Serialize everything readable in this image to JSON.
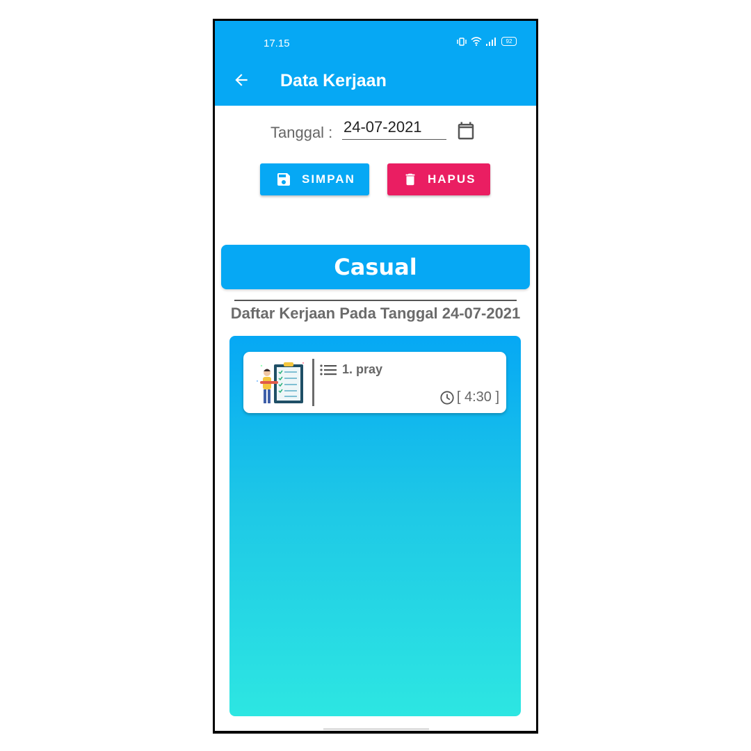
{
  "status_bar": {
    "time": "17.15",
    "battery": "92"
  },
  "header": {
    "title": "Data Kerjaan"
  },
  "date_form": {
    "label": "Tanggal :",
    "value": "24-07-2021"
  },
  "actions": {
    "save_label": "SIMPAN",
    "delete_label": "HAPUS"
  },
  "category": {
    "name": "Casual"
  },
  "list": {
    "heading": "Daftar Kerjaan Pada Tanggal 24-07-2021",
    "items": [
      {
        "task": "1. pray",
        "time": "[ 4:30 ]"
      }
    ]
  },
  "colors": {
    "primary": "#06a8f4",
    "danger": "#ea1e62",
    "gradient_end": "#2de6e2"
  }
}
